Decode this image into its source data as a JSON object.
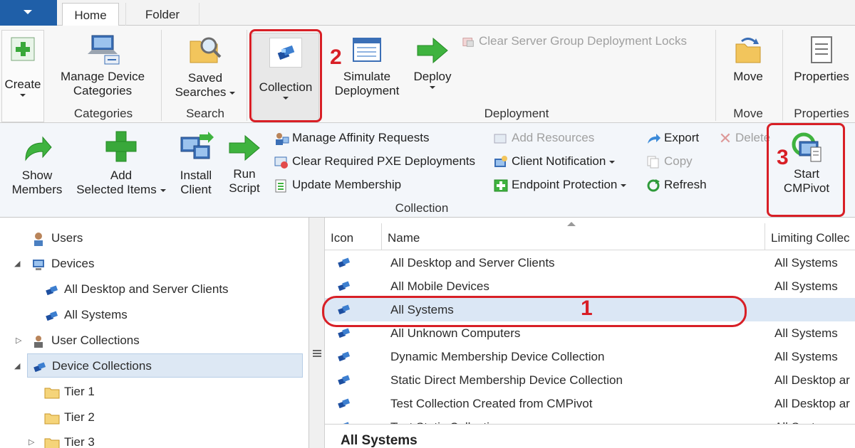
{
  "tabs": {
    "home": "Home",
    "folder": "Folder"
  },
  "ribbon_top": {
    "create": "Create",
    "manage_device_categories": [
      "Manage Device",
      "Categories"
    ],
    "categories_group": "Categories",
    "saved_searches": [
      "Saved",
      "Searches"
    ],
    "search_group": "Search",
    "collection": "Collection",
    "simulate_deployment": [
      "Simulate",
      "Deployment"
    ],
    "deploy": "Deploy",
    "clear_locks": "Clear Server Group Deployment Locks",
    "deployment_group": "Deployment",
    "move": "Move",
    "move_group": "Move",
    "properties": "Properties",
    "properties_group": "Properties"
  },
  "ribbon_collection": {
    "show_members": [
      "Show",
      "Members"
    ],
    "add_selected_items": [
      "Add",
      "Selected Items"
    ],
    "install_client": [
      "Install",
      "Client"
    ],
    "run_script": [
      "Run",
      "Script"
    ],
    "manage_affinity": "Manage Affinity Requests",
    "clear_pxe": "Clear Required PXE Deployments",
    "update_membership": "Update Membership",
    "add_resources": "Add Resources",
    "client_notification": "Client Notification",
    "endpoint_protection": "Endpoint Protection",
    "export": "Export",
    "copy": "Copy",
    "refresh": "Refresh",
    "delete": "Delete",
    "start_cmpivot": [
      "Start",
      "CMPivot"
    ],
    "group_label": "Collection"
  },
  "nav": {
    "items": [
      "Users",
      "Devices",
      "All Desktop and Server Clients",
      "All Systems",
      "User Collections",
      "Device Collections",
      "Tier 1",
      "Tier 2",
      "Tier 3"
    ]
  },
  "list": {
    "columns": [
      "Icon",
      "Name",
      "Limiting Collec"
    ],
    "rows": [
      {
        "name": "All Desktop and Server Clients",
        "limiting": "All Systems"
      },
      {
        "name": "All Mobile Devices",
        "limiting": "All Systems"
      },
      {
        "name": "All Systems",
        "limiting": ""
      },
      {
        "name": "All Unknown Computers",
        "limiting": "All Systems"
      },
      {
        "name": "Dynamic Membership Device Collection",
        "limiting": "All Systems"
      },
      {
        "name": "Static Direct Membership Device Collection",
        "limiting": "All Desktop ar"
      },
      {
        "name": "Test Collection Created from CMPivot",
        "limiting": "All Desktop ar"
      },
      {
        "name": "Test Static Collection",
        "limiting": "All Syst"
      }
    ]
  },
  "details_title": "All Systems",
  "annotations": {
    "one": "1",
    "two": "2",
    "three": "3"
  },
  "colors": {
    "accent": "#1f5fa8",
    "annotation": "#d81f26",
    "selection": "#dbe7f5"
  }
}
